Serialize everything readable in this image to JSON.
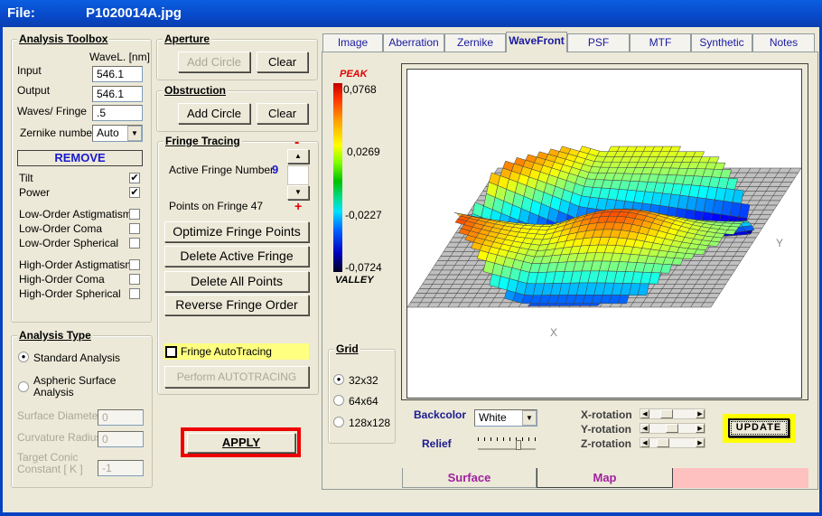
{
  "window": {
    "file_label": "File:",
    "file_name": "P1020014A.jpg"
  },
  "toolbox": {
    "title": "Analysis Toolbox",
    "wavel_header": "WaveL. [nm]",
    "input_label": "Input",
    "input_value": "546.1",
    "output_label": "Output",
    "output_value": "546.1",
    "waves_label": "Waves/ Fringe",
    "waves_value": ".5",
    "zernike_label": "Zernike number",
    "zernike_value": "Auto",
    "remove_label": "REMOVE",
    "items": [
      {
        "label": "Tilt",
        "checked": true
      },
      {
        "label": "Power",
        "checked": true
      },
      {
        "label": "Low-Order  Astigmatism",
        "checked": false
      },
      {
        "label": "Low-Order  Coma",
        "checked": false
      },
      {
        "label": "Low-Order  Spherical",
        "checked": false
      },
      {
        "label": "High-Order  Astigmatism",
        "checked": false
      },
      {
        "label": "High-Order  Coma",
        "checked": false
      },
      {
        "label": "High-Order  Spherical",
        "checked": false
      }
    ]
  },
  "analysis_type": {
    "title": "Analysis Type",
    "standard": "Standard  Analysis",
    "aspheric": "Aspheric  Surface Analysis",
    "selected": "standard",
    "surface_diameter_label": "Surface Diameter",
    "surface_diameter_value": "0",
    "curvature_label": "Curvature Radius",
    "curvature_value": "0",
    "conic_label": "Target Conic Constant [ K ]",
    "conic_value": "-1"
  },
  "aperture": {
    "title": "Aperture",
    "add": "Add Circle",
    "clear": "Clear"
  },
  "obstruction": {
    "title": "Obstruction",
    "add": "Add Circle",
    "clear": "Clear"
  },
  "fringe": {
    "title": "Fringe Tracing",
    "minus": "-",
    "plus": "+",
    "active_label": "Active Fringe Number",
    "active_value": "9",
    "points_label": "Points on  Fringe 47",
    "optimize": "Optimize Fringe Points",
    "delete_active": "Delete Active Fringe",
    "delete_all": "Delete  All  Points",
    "reverse": "Reverse  Fringe Order",
    "autotracing": "Fringe AutoTracing",
    "autotracing_checked": false,
    "perform": "Perform  AUTOTRACING"
  },
  "apply": "APPLY",
  "tabs": [
    {
      "label": "Image"
    },
    {
      "label": "Aberration"
    },
    {
      "label": "Zernike"
    },
    {
      "label": "WaveFront",
      "active": true
    },
    {
      "label": "PSF"
    },
    {
      "label": "MTF"
    },
    {
      "label": "Synthetic"
    },
    {
      "label": "Notes"
    }
  ],
  "colorbar": {
    "peak": "PEAK",
    "valley": "VALLEY",
    "ticks": [
      "0,0768",
      "0,0269",
      "-0,0227",
      "-0,0724"
    ]
  },
  "plot": {
    "x_axis": "X",
    "y_axis": "Y"
  },
  "grid": {
    "title": "Grid",
    "options": [
      "32x32",
      "64x64",
      "128x128"
    ],
    "selected": "32x32"
  },
  "controls": {
    "backcolor_label": "Backcolor",
    "backcolor_value": "White",
    "relief_label": "Relief",
    "relief_level": 0.7,
    "x_rotation": "X-rotation",
    "y_rotation": "Y-rotation",
    "z_rotation": "Z-rotation",
    "update": "UPDATE"
  },
  "bottom_tabs": {
    "surface": "Surface",
    "map": "Map"
  },
  "colors": {
    "title_blue": "#0a5fe0",
    "apply_border": "#ee0000",
    "highlight_yellow": "#ffff80",
    "bottom_tab_pink": "#ffc0c0",
    "tab_text": "#1a1aa0",
    "bottom_tab_text": "#a020a0"
  }
}
